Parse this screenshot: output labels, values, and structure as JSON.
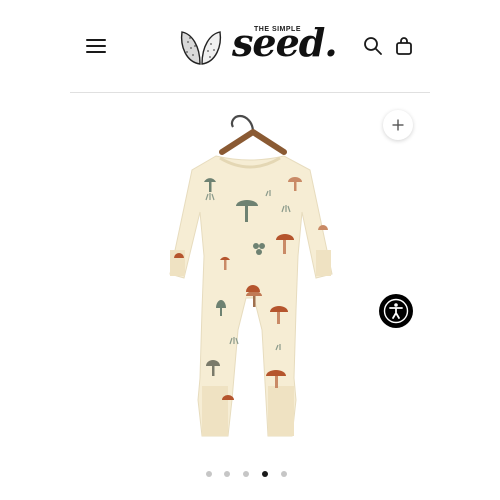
{
  "header": {
    "logo_small": "THE SIMPLE",
    "logo_word": "seed.",
    "menu_icon": "hamburger-icon",
    "search_icon": "search-icon",
    "bag_icon": "shopping-bag-icon"
  },
  "product": {
    "image_icon": "romper-image",
    "zoom_icon": "plus-icon",
    "accessibility_icon": "accessibility-icon"
  },
  "carousel": {
    "total": 5,
    "active": 4
  },
  "colors": {
    "fabric": "#f6edd4",
    "mushroom_red": "#b5552d",
    "mushroom_green": "#6e8272",
    "text": "#1a1a1a"
  }
}
